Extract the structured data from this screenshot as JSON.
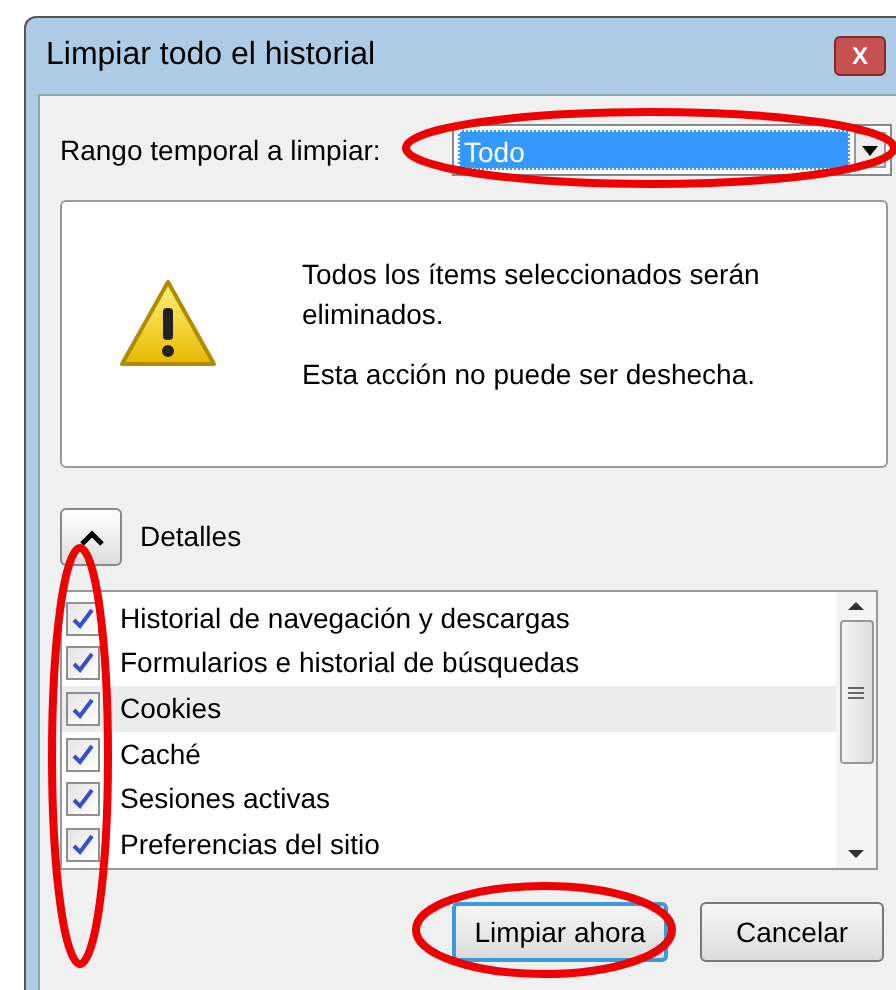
{
  "window": {
    "title": "Limpiar todo el historial",
    "close_button": "X"
  },
  "time_range": {
    "label": "Rango temporal a limpiar:",
    "value": "Todo"
  },
  "warning": {
    "lines": [
      "Todos los ítems seleccionados serán eliminados.",
      "Esta acción no puede ser deshecha."
    ]
  },
  "details": {
    "label": "Detalles",
    "expanded": true
  },
  "items": [
    {
      "label": "Historial de navegación y descargas",
      "checked": true,
      "selected": false
    },
    {
      "label": "Formularios e historial de búsquedas",
      "checked": true,
      "selected": false
    },
    {
      "label": "Cookies",
      "checked": true,
      "selected": true
    },
    {
      "label": "Caché",
      "checked": true,
      "selected": false
    },
    {
      "label": "Sesiones activas",
      "checked": true,
      "selected": false
    },
    {
      "label": "Preferencias del sitio",
      "checked": true,
      "selected": false
    }
  ],
  "buttons": [
    {
      "label": "Limpiar ahora",
      "default": true
    },
    {
      "label": "Cancelar",
      "default": false
    }
  ]
}
